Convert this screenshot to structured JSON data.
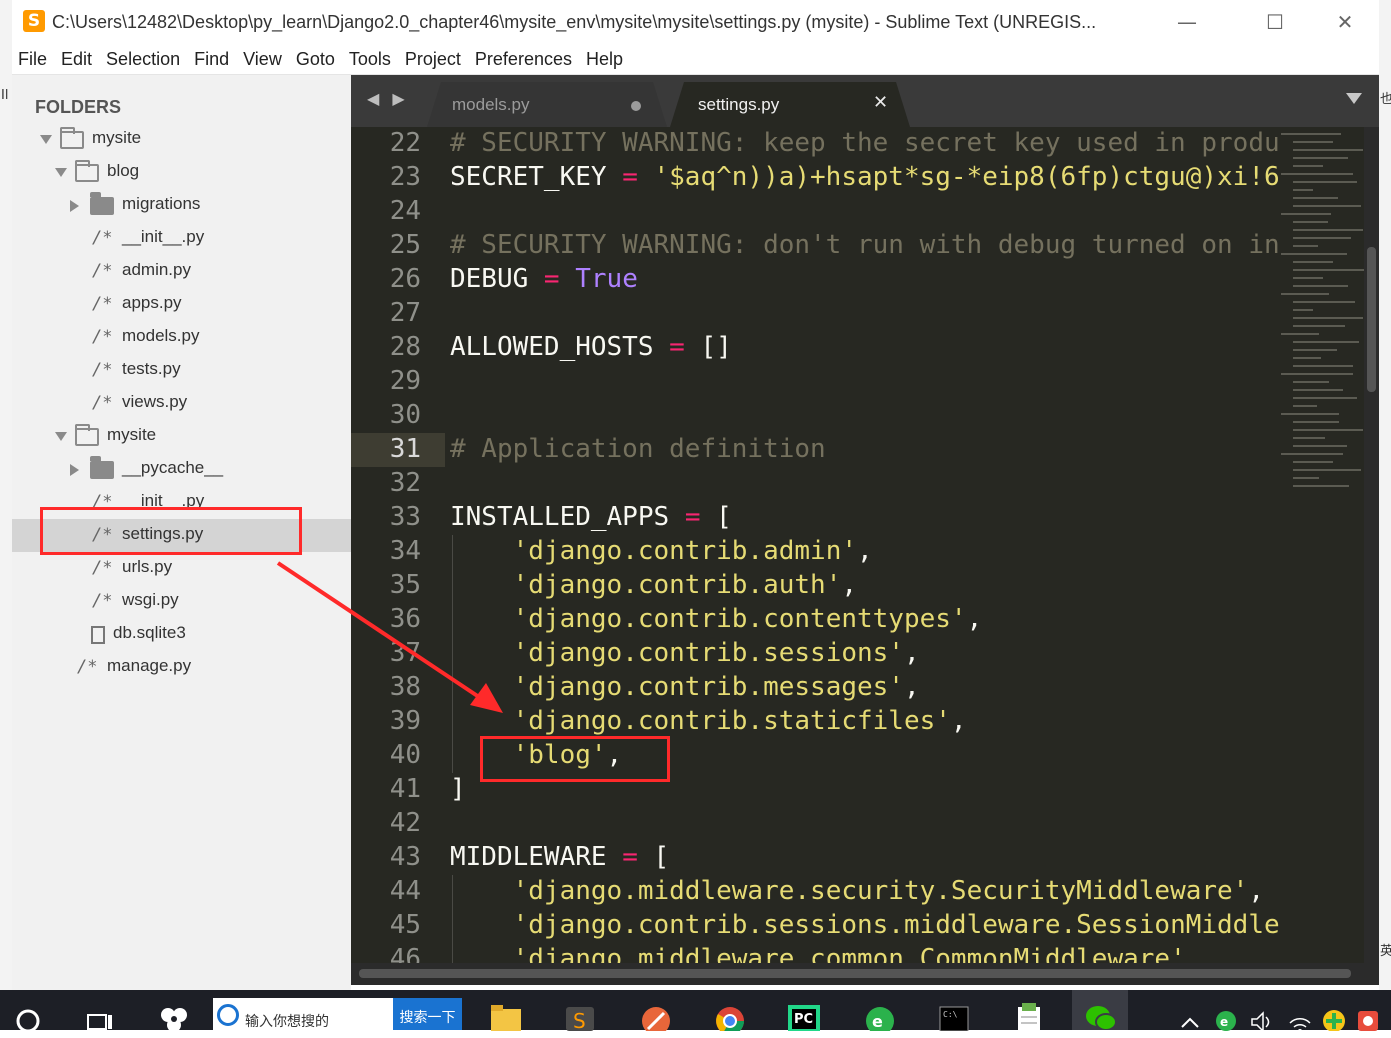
{
  "window": {
    "title": "C:\\Users\\12482\\Desktop\\py_learn\\Django2.0_chapter46\\mysite_env\\mysite\\mysite\\settings.py (mysite) - Sublime Text (UNREGIS...",
    "app_icon": "S",
    "buttons": {
      "minimize": "—",
      "maximize": "☐",
      "close": "✕"
    }
  },
  "menu": [
    "File",
    "Edit",
    "Selection",
    "Find",
    "View",
    "Goto",
    "Tools",
    "Project",
    "Preferences",
    "Help"
  ],
  "sidebar": {
    "header": "FOLDERS",
    "items": [
      {
        "label": "mysite",
        "kind": "folder-open"
      },
      {
        "label": "blog",
        "kind": "folder-open"
      },
      {
        "label": "migrations",
        "kind": "folder-closed"
      },
      {
        "label": "__init__.py",
        "kind": "file"
      },
      {
        "label": "admin.py",
        "kind": "file"
      },
      {
        "label": "apps.py",
        "kind": "file"
      },
      {
        "label": "models.py",
        "kind": "file"
      },
      {
        "label": "tests.py",
        "kind": "file"
      },
      {
        "label": "views.py",
        "kind": "file"
      },
      {
        "label": "mysite",
        "kind": "folder-open"
      },
      {
        "label": "__pycache__",
        "kind": "folder-closed"
      },
      {
        "label": "__init__.py",
        "kind": "file"
      },
      {
        "label": "settings.py",
        "kind": "file",
        "selected": true
      },
      {
        "label": "urls.py",
        "kind": "file"
      },
      {
        "label": "wsgi.py",
        "kind": "file"
      },
      {
        "label": "db.sqlite3",
        "kind": "doc"
      },
      {
        "label": "manage.py",
        "kind": "file"
      }
    ],
    "file_glyph": "/*"
  },
  "tabs": {
    "nav": "◀ ▶",
    "items": [
      {
        "label": "models.py",
        "active": false,
        "dirty": true
      },
      {
        "label": "settings.py",
        "active": true,
        "close": "✕"
      }
    ]
  },
  "editor": {
    "current_line": "31",
    "lines": [
      {
        "n": "22",
        "parts": [
          [
            "c-com",
            "# SECURITY WARNING: keep the secret key used in produ"
          ]
        ]
      },
      {
        "n": "23",
        "parts": [
          [
            "",
            "SECRET_KEY "
          ],
          [
            "c-op",
            "="
          ],
          [
            "",
            " "
          ],
          [
            "c-str",
            "'$aq^n))a)+hsapt*sg-*eip8(6fp)ctgu@)xi!6"
          ]
        ]
      },
      {
        "n": "24",
        "parts": []
      },
      {
        "n": "25",
        "parts": [
          [
            "c-com",
            "# SECURITY WARNING: don't run with debug turned on in"
          ]
        ]
      },
      {
        "n": "26",
        "parts": [
          [
            "",
            "DEBUG "
          ],
          [
            "c-op",
            "="
          ],
          [
            "",
            " "
          ],
          [
            "c-const",
            "True"
          ]
        ]
      },
      {
        "n": "27",
        "parts": []
      },
      {
        "n": "28",
        "parts": [
          [
            "",
            "ALLOWED_HOSTS "
          ],
          [
            "c-op",
            "="
          ],
          [
            "",
            " []"
          ]
        ]
      },
      {
        "n": "29",
        "parts": []
      },
      {
        "n": "30",
        "parts": []
      },
      {
        "n": "31",
        "parts": [
          [
            "c-com",
            "# Application definition"
          ]
        ]
      },
      {
        "n": "32",
        "parts": []
      },
      {
        "n": "33",
        "parts": [
          [
            "",
            "INSTALLED_APPS "
          ],
          [
            "c-op",
            "="
          ],
          [
            "",
            " ["
          ]
        ]
      },
      {
        "n": "34",
        "parts": [
          [
            "",
            "    "
          ],
          [
            "c-str",
            "'django.contrib.admin'"
          ],
          [
            "",
            ","
          ]
        ]
      },
      {
        "n": "35",
        "parts": [
          [
            "",
            "    "
          ],
          [
            "c-str",
            "'django.contrib.auth'"
          ],
          [
            "",
            ","
          ]
        ]
      },
      {
        "n": "36",
        "parts": [
          [
            "",
            "    "
          ],
          [
            "c-str",
            "'django.contrib.contenttypes'"
          ],
          [
            "",
            ","
          ]
        ]
      },
      {
        "n": "37",
        "parts": [
          [
            "",
            "    "
          ],
          [
            "c-str",
            "'django.contrib.sessions'"
          ],
          [
            "",
            ","
          ]
        ]
      },
      {
        "n": "38",
        "parts": [
          [
            "",
            "    "
          ],
          [
            "c-str",
            "'django.contrib.messages'"
          ],
          [
            "",
            ","
          ]
        ]
      },
      {
        "n": "39",
        "parts": [
          [
            "",
            "    "
          ],
          [
            "c-str",
            "'django.contrib.staticfiles'"
          ],
          [
            "",
            ","
          ]
        ]
      },
      {
        "n": "40",
        "parts": [
          [
            "",
            "    "
          ],
          [
            "c-str",
            "'blog'"
          ],
          [
            "",
            ","
          ]
        ]
      },
      {
        "n": "41",
        "parts": [
          [
            "",
            "]"
          ]
        ]
      },
      {
        "n": "42",
        "parts": []
      },
      {
        "n": "43",
        "parts": [
          [
            "",
            "MIDDLEWARE "
          ],
          [
            "c-op",
            "="
          ],
          [
            "",
            " ["
          ]
        ]
      },
      {
        "n": "44",
        "parts": [
          [
            "",
            "    "
          ],
          [
            "c-str",
            "'django.middleware.security.SecurityMiddleware'"
          ],
          [
            "",
            ","
          ]
        ]
      },
      {
        "n": "45",
        "parts": [
          [
            "",
            "    "
          ],
          [
            "c-str",
            "'django.contrib.sessions.middleware.SessionMiddle"
          ]
        ]
      },
      {
        "n": "46",
        "parts": [
          [
            "",
            "    "
          ],
          [
            "c-str",
            "'django.middleware.common.CommonMiddleware'"
          ],
          [
            "",
            ","
          ]
        ]
      }
    ]
  },
  "desktop": {
    "left_strip": "Il",
    "right_strip": "也",
    "right_strip_bottom": "英"
  },
  "taskbar": {
    "search_text": "输入你想搜的",
    "search_button": "搜索一下",
    "apps": [
      "cortana-icon",
      "task-view-icon",
      "pinwheel-app-icon",
      "file-explorer-icon",
      "sublime-text-icon",
      "pen-app-icon",
      "chrome-icon",
      "pycharm-icon",
      "green-browser-icon",
      "terminal-icon",
      "notepad-icon",
      "wechat-icon"
    ],
    "tray": [
      "chevron-up-icon",
      "green-e-icon",
      "volume-icon",
      "wifi-icon",
      "green-plus-icon",
      "tray-app-icon"
    ]
  },
  "colors": {
    "accent_annotation": "#ff2a2a",
    "editor_bg": "#272822",
    "comment": "#75715e",
    "string": "#e6db74",
    "operator": "#f92672",
    "constant": "#ae81ff"
  }
}
